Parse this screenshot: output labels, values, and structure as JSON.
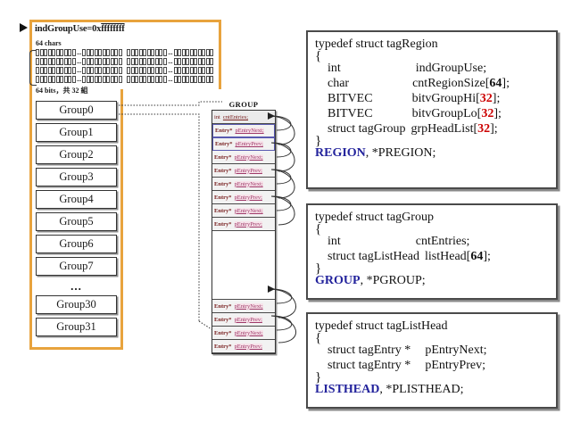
{
  "diagram": {
    "title": "Region / Group / ListHead data structure layout",
    "colors": {
      "region_frame": "#E8A33D",
      "typedef_name": "#23239C",
      "array_size_accent": "#CC0000",
      "entry_type": "#7A2222",
      "entry_field": "#A03A6A"
    }
  },
  "region_block": {
    "ind_group_use_label": "indGroupUse=0x",
    "ind_group_use_value": "ffffffff",
    "chars_label": "64 chars",
    "bits_label": "64 bits，共 32 組",
    "bit_grid": {
      "rows": 4,
      "cells_per_segment": 10,
      "segments_per_row": 4,
      "ellipsis": "..."
    }
  },
  "group_list": {
    "items": [
      {
        "label": "Group0"
      },
      {
        "label": "Group1"
      },
      {
        "label": "Group2"
      },
      {
        "label": "Group3"
      },
      {
        "label": "Group4"
      },
      {
        "label": "Group5"
      },
      {
        "label": "Group6"
      },
      {
        "label": "Group7"
      }
    ],
    "ellipsis": "...",
    "tail_items": [
      {
        "label": "Group30"
      },
      {
        "label": "Group31"
      }
    ]
  },
  "group_table": {
    "title": "GROUP",
    "header": {
      "type": "int",
      "name": "cntEntries;"
    },
    "top_rows": [
      {
        "type": "Entry*",
        "name": "pEntryNext;"
      },
      {
        "type": "Entry*",
        "name": "pEntryPrev;"
      },
      {
        "type": "Entry*",
        "name": "pEntryNext;"
      },
      {
        "type": "Entry*",
        "name": "pEntryPrev;"
      },
      {
        "type": "Entry*",
        "name": "pEntryNext;"
      },
      {
        "type": "Entry*",
        "name": "pEntryPrev;"
      },
      {
        "type": "Entry*",
        "name": "pEntryNext;"
      },
      {
        "type": "Entry*",
        "name": "pEntryPrev;"
      }
    ],
    "bottom_rows": [
      {
        "type": "Entry*",
        "name": "pEntryNext;"
      },
      {
        "type": "Entry*",
        "name": "pEntryPrev;"
      },
      {
        "type": "Entry*",
        "name": "pEntryNext;"
      },
      {
        "type": "Entry*",
        "name": "pEntryPrev;"
      }
    ]
  },
  "code_region": {
    "l1": "typedef struct tagRegion",
    "l2": "{",
    "f1_type": "int",
    "f1_name": "indGroupUse;",
    "f2_type": "char",
    "f2_name": "cntRegionSize[",
    "f2_size": "64",
    "f2_tail": "];",
    "f3_type": "BITVEC",
    "f3_name": "bitvGroupHi[",
    "f3_size": "32",
    "f3_tail": "];",
    "f4_type": "BITVEC",
    "f4_name": "bitvGroupLo[",
    "f4_size": "32",
    "f4_tail": "];",
    "f5_type": "struct tagGroup",
    "f5_name": "grpHeadList[",
    "f5_size": "32",
    "f5_tail": "];",
    "l_close": "}",
    "typename": "REGION",
    "typetail": ", *PREGION;"
  },
  "code_group": {
    "l1": "typedef struct tagGroup",
    "l2": "{",
    "f1_type": "int",
    "f1_name": "cntEntries;",
    "f2_type": "struct tagListHead",
    "f2_name": "listHead[",
    "f2_size": "64",
    "f2_tail": "];",
    "l_close": "}",
    "typename": "GROUP",
    "typetail": ", *PGROUP;"
  },
  "code_listhead": {
    "l1": "typedef struct tagListHead",
    "l2": "{",
    "f1_type": "struct tagEntry *",
    "f1_name": "pEntryNext;",
    "f2_type": "struct tagEntry *",
    "f2_name": "pEntryPrev;",
    "l_close": "}",
    "typename": "LISTHEAD",
    "typetail": ", *PLISTHEAD;"
  }
}
